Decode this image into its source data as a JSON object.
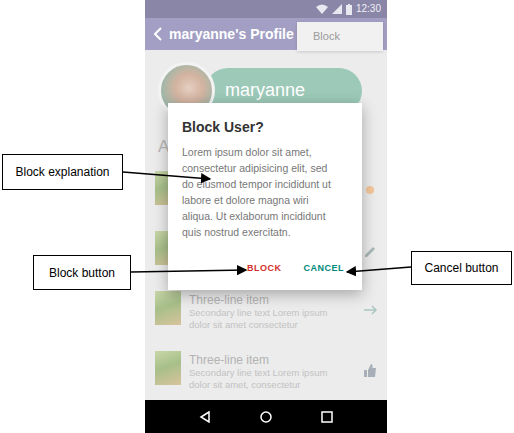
{
  "status_bar": {
    "time": "12:30"
  },
  "app_bar": {
    "title": "maryanne's Profile"
  },
  "menu": {
    "items": [
      "Block"
    ]
  },
  "profile": {
    "name": "maryanne"
  },
  "section": {
    "label": "A"
  },
  "list": {
    "rows": [
      {
        "kind": "covered"
      },
      {
        "kind": "covered"
      },
      {
        "kind": "three-line",
        "title": "Three-line item",
        "lines": [
          "Secondary line text Lorem ipsum",
          "dolor sit amet consectetur"
        ]
      },
      {
        "kind": "three-line",
        "title": "Three-line item",
        "lines": [
          "Secondary line text Lorem ipsum",
          "dolor sit amet, consectetur"
        ]
      }
    ]
  },
  "dialog": {
    "title": "Block User?",
    "body": [
      "Lorem ipsum dolor sit amet,",
      "consectetur adipisicing elit, sed",
      "do eiusmod tempor incididunt ut",
      "labore et dolore magna wiri",
      "aliqua. Ut exlaborum incididunt",
      "quis nostrud exercitatn."
    ],
    "buttons": [
      {
        "label": "BLOCK",
        "color": "#d32f2f"
      },
      {
        "label": "CANCEL",
        "color": "#00897b"
      }
    ]
  },
  "callouts": [
    {
      "label": "Block explanation"
    },
    {
      "label": "Block button"
    },
    {
      "label": "Cancel button"
    }
  ]
}
